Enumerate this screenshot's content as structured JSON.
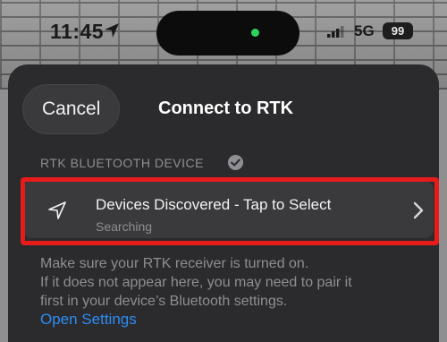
{
  "status_bar": {
    "time": "11:45",
    "network": "5G",
    "battery": "99"
  },
  "sheet": {
    "cancel_label": "Cancel",
    "title": "Connect to RTK"
  },
  "section": {
    "header": "RTK BLUETOOTH DEVICE"
  },
  "device_row": {
    "title": "Devices Discovered - Tap to Select",
    "subtitle": "Searching"
  },
  "help": {
    "lines": [
      "Make sure your RTK receiver is turned on.",
      "If it does not appear here, you may need to pair it",
      "first in your device’s Bluetooth settings."
    ],
    "link_label": "Open Settings"
  },
  "colors": {
    "accent_link": "#2c8cf4",
    "highlight": "#e81b1b",
    "sheet_bg": "#2b2b2d",
    "row_bg": "#3a3a3c",
    "camera_indicator": "#2fd35b"
  },
  "icons": {
    "status": [
      "location-arrow-icon",
      "signal-icon"
    ],
    "section": "verified-check-icon",
    "row": [
      "navigation-arrow-icon",
      "chevron-right-icon"
    ]
  }
}
